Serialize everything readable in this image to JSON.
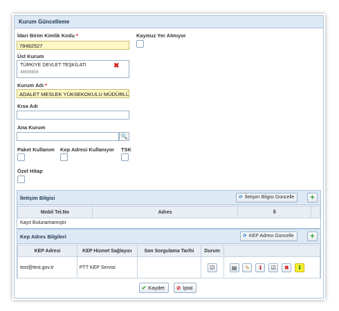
{
  "panel": {
    "title": "Kurum Güncelleme"
  },
  "form": {
    "idari_kod_label": "İdari Birim Kimlik Kodu",
    "required_mark": "*",
    "idari_kod_value": "78492527",
    "kayit_label": "Kayıtsız Yer Almıyor",
    "ust_kurum_label": "Üst Kurum",
    "ust_kurum_name": "TÜRKİYE DEVLET TEŞKİLATI",
    "ust_kurum_code": "48606806",
    "kurum_adi_label": "Kurum Adı",
    "kurum_adi_value": "ADALET MESLEK YÜKSEKOKULU MÜDÜRLÜĞ",
    "kisa_adi_label": "Kısa Adı",
    "kisa_adi_value": "",
    "ana_kurum_label": "Ana Kurum",
    "ana_kurum_value": "",
    "paket_label": "Paket Kullanım",
    "kep_kullaniyor_label": "Kep Adresi Kullanıyor",
    "tsk_label": "TSK",
    "ozel_hitap_label": "Özel Hitap"
  },
  "iletisim": {
    "title": "İletişim Bilgisi",
    "update_button": "İletişim Bilgisi Güncelle",
    "columns": [
      "Mobil Tel.No",
      "Adres",
      "İl"
    ],
    "empty_text": "Kayıt Bulunamamıştır"
  },
  "kep": {
    "title": "Kep Adres Bilgileri",
    "update_button": "KEP Adresi Güncelle",
    "columns": [
      "KEP Adresi",
      "KEP Hizmet Sağlayıcı",
      "Son Sorgulama Tarihi",
      "Durum"
    ],
    "rows": [
      {
        "adres": "test@test.gov.tr",
        "saglayici": "PTT KEP Servisi",
        "tarih": ""
      }
    ]
  },
  "footer": {
    "save": "Kaydet",
    "cancel": "İptal"
  },
  "icons": {
    "refresh": "refresh-icon",
    "add": "plus-icon",
    "delete": "close-icon",
    "lookup": "folder-search-icon",
    "status": "check-icon",
    "colors": {
      "accent": "#dde9f5",
      "required": "#dd0000",
      "highlight": "#f4ee2d"
    }
  }
}
